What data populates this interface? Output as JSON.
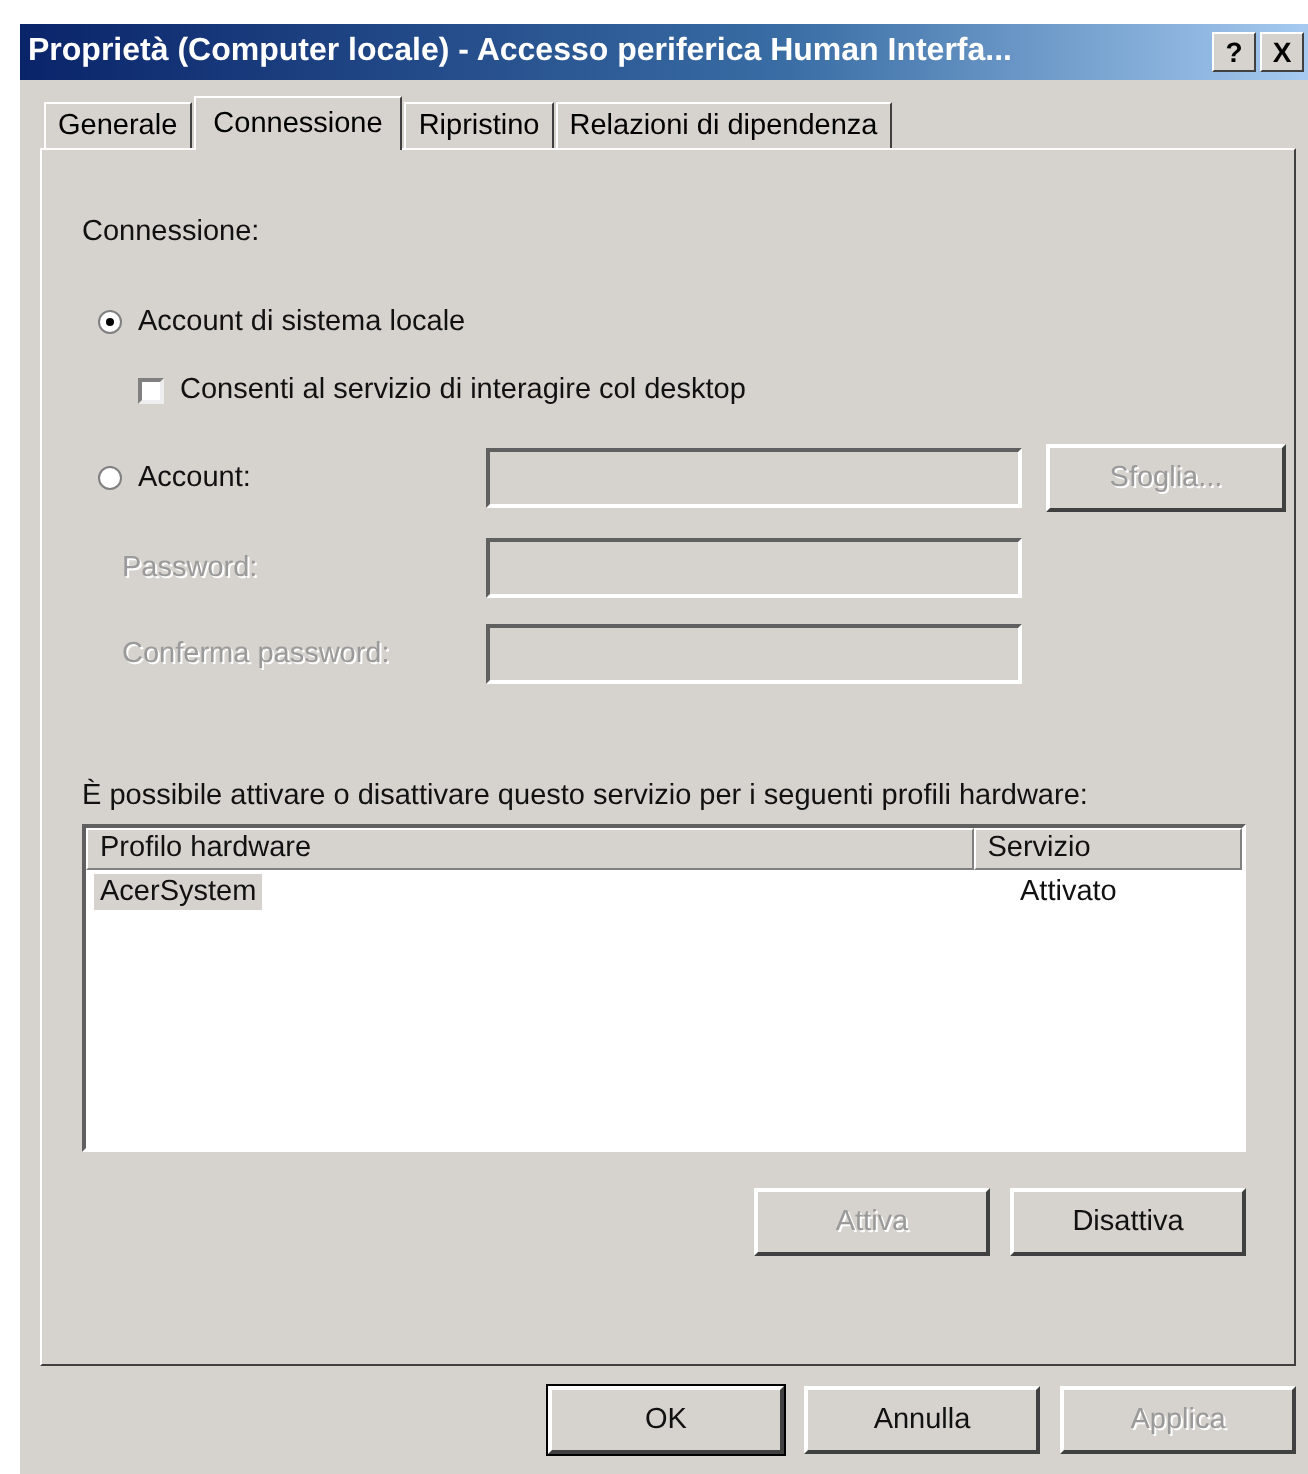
{
  "window": {
    "title": "Proprietà (Computer locale) - Accesso periferica Human Interfa...",
    "help_button": "?",
    "close_button": "X"
  },
  "tabs": [
    {
      "label": "Generale",
      "selected": false
    },
    {
      "label": "Connessione",
      "selected": true
    },
    {
      "label": "Ripristino",
      "selected": false
    },
    {
      "label": "Relazioni di dipendenza",
      "selected": false
    }
  ],
  "connection": {
    "label": "Connessione:",
    "local_account": {
      "label": "Account di sistema locale",
      "selected": true
    },
    "desktop_interaction": {
      "label": "Consenti al servizio di interagire col desktop",
      "checked": false
    },
    "account": {
      "label": "Account:",
      "selected": false,
      "field_disabled": true
    },
    "fields": [
      {
        "label": "Password:",
        "disabled": true
      },
      {
        "label": "Conferma password:",
        "disabled": true
      }
    ],
    "browse_button": {
      "label": "Sfoglia...",
      "disabled": true
    }
  },
  "profiles": {
    "caption": "È possibile attivare o disattivare questo servizio per i seguenti profili hardware:",
    "columns": [
      "Profilo hardware",
      "Servizio"
    ],
    "rows": [
      {
        "profile": "AcerSystem",
        "service": "Attivato",
        "selected": true
      }
    ],
    "buttons": [
      {
        "label": "Attiva",
        "disabled": true
      },
      {
        "label": "Disattiva",
        "disabled": false
      }
    ]
  },
  "footer_buttons": [
    {
      "label": "OK",
      "disabled": false,
      "default": true
    },
    {
      "label": "Annulla",
      "disabled": false,
      "default": false
    },
    {
      "label": "Applica",
      "disabled": true,
      "default": false
    }
  ]
}
